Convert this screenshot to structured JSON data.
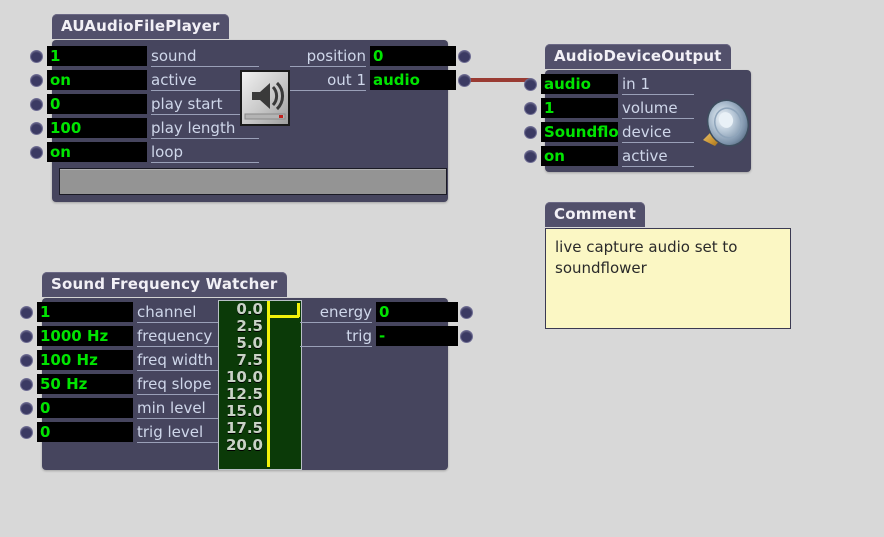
{
  "canvas": {
    "background": "#d8d8d8",
    "accent_green": "#00e400",
    "node_body": "#46455e",
    "node_title": "#52506b",
    "wire_color": "#9a3b33"
  },
  "nodes": {
    "au_audio_file_player": {
      "title": "AUAudioFilePlayer",
      "inputs": [
        {
          "value": "1",
          "label": "sound"
        },
        {
          "value": "on",
          "label": "active"
        },
        {
          "value": "0",
          "label": "play start"
        },
        {
          "value": "100",
          "label": "play length"
        },
        {
          "value": "on",
          "label": "loop"
        }
      ],
      "outputs": [
        {
          "label": "position",
          "value": "0"
        },
        {
          "label": "out 1",
          "value": "audio"
        }
      ],
      "icon": "speaker-gray-icon",
      "scrubbar": "playback-scrub-bar"
    },
    "audio_device_output": {
      "title": "AudioDeviceOutput",
      "inputs": [
        {
          "value": "audio",
          "label": "in 1"
        },
        {
          "value": "1",
          "label": "volume"
        },
        {
          "value": "Soundflo",
          "label": "device"
        },
        {
          "value": "on",
          "label": "active"
        }
      ],
      "icon": "speaker-blue-icon"
    },
    "sound_frequency_watcher": {
      "title": "Sound Frequency Watcher",
      "inputs": [
        {
          "value": "1",
          "label": "channel"
        },
        {
          "value": "1000 Hz",
          "label": "frequency"
        },
        {
          "value": "100 Hz",
          "label": "freq width"
        },
        {
          "value": "50 Hz",
          "label": "freq slope"
        },
        {
          "value": "0",
          "label": "min level"
        },
        {
          "value": "0",
          "label": "trig level"
        }
      ],
      "outputs": [
        {
          "label": "energy",
          "value": "0"
        },
        {
          "label": "trig",
          "value": "-"
        }
      ]
    },
    "comment": {
      "title": "Comment",
      "text": "live capture audio set to soundflower"
    }
  },
  "chart_data": {
    "type": "line",
    "title": "",
    "xlabel": "",
    "ylabel": "",
    "tick_labels": [
      "0.0",
      "2.5",
      "5.0",
      "7.5",
      "10.0",
      "12.5",
      "15.0",
      "17.5",
      "20.0"
    ],
    "ylim": [
      0,
      20
    ],
    "grid": false,
    "series": [
      {
        "name": "energy",
        "values": [
          1.0,
          1.0,
          1.0,
          1.0,
          1.0
        ]
      }
    ],
    "axis_color": "#f2f20a",
    "trace_color": "#f2f20a",
    "background": "#0b3a08"
  }
}
